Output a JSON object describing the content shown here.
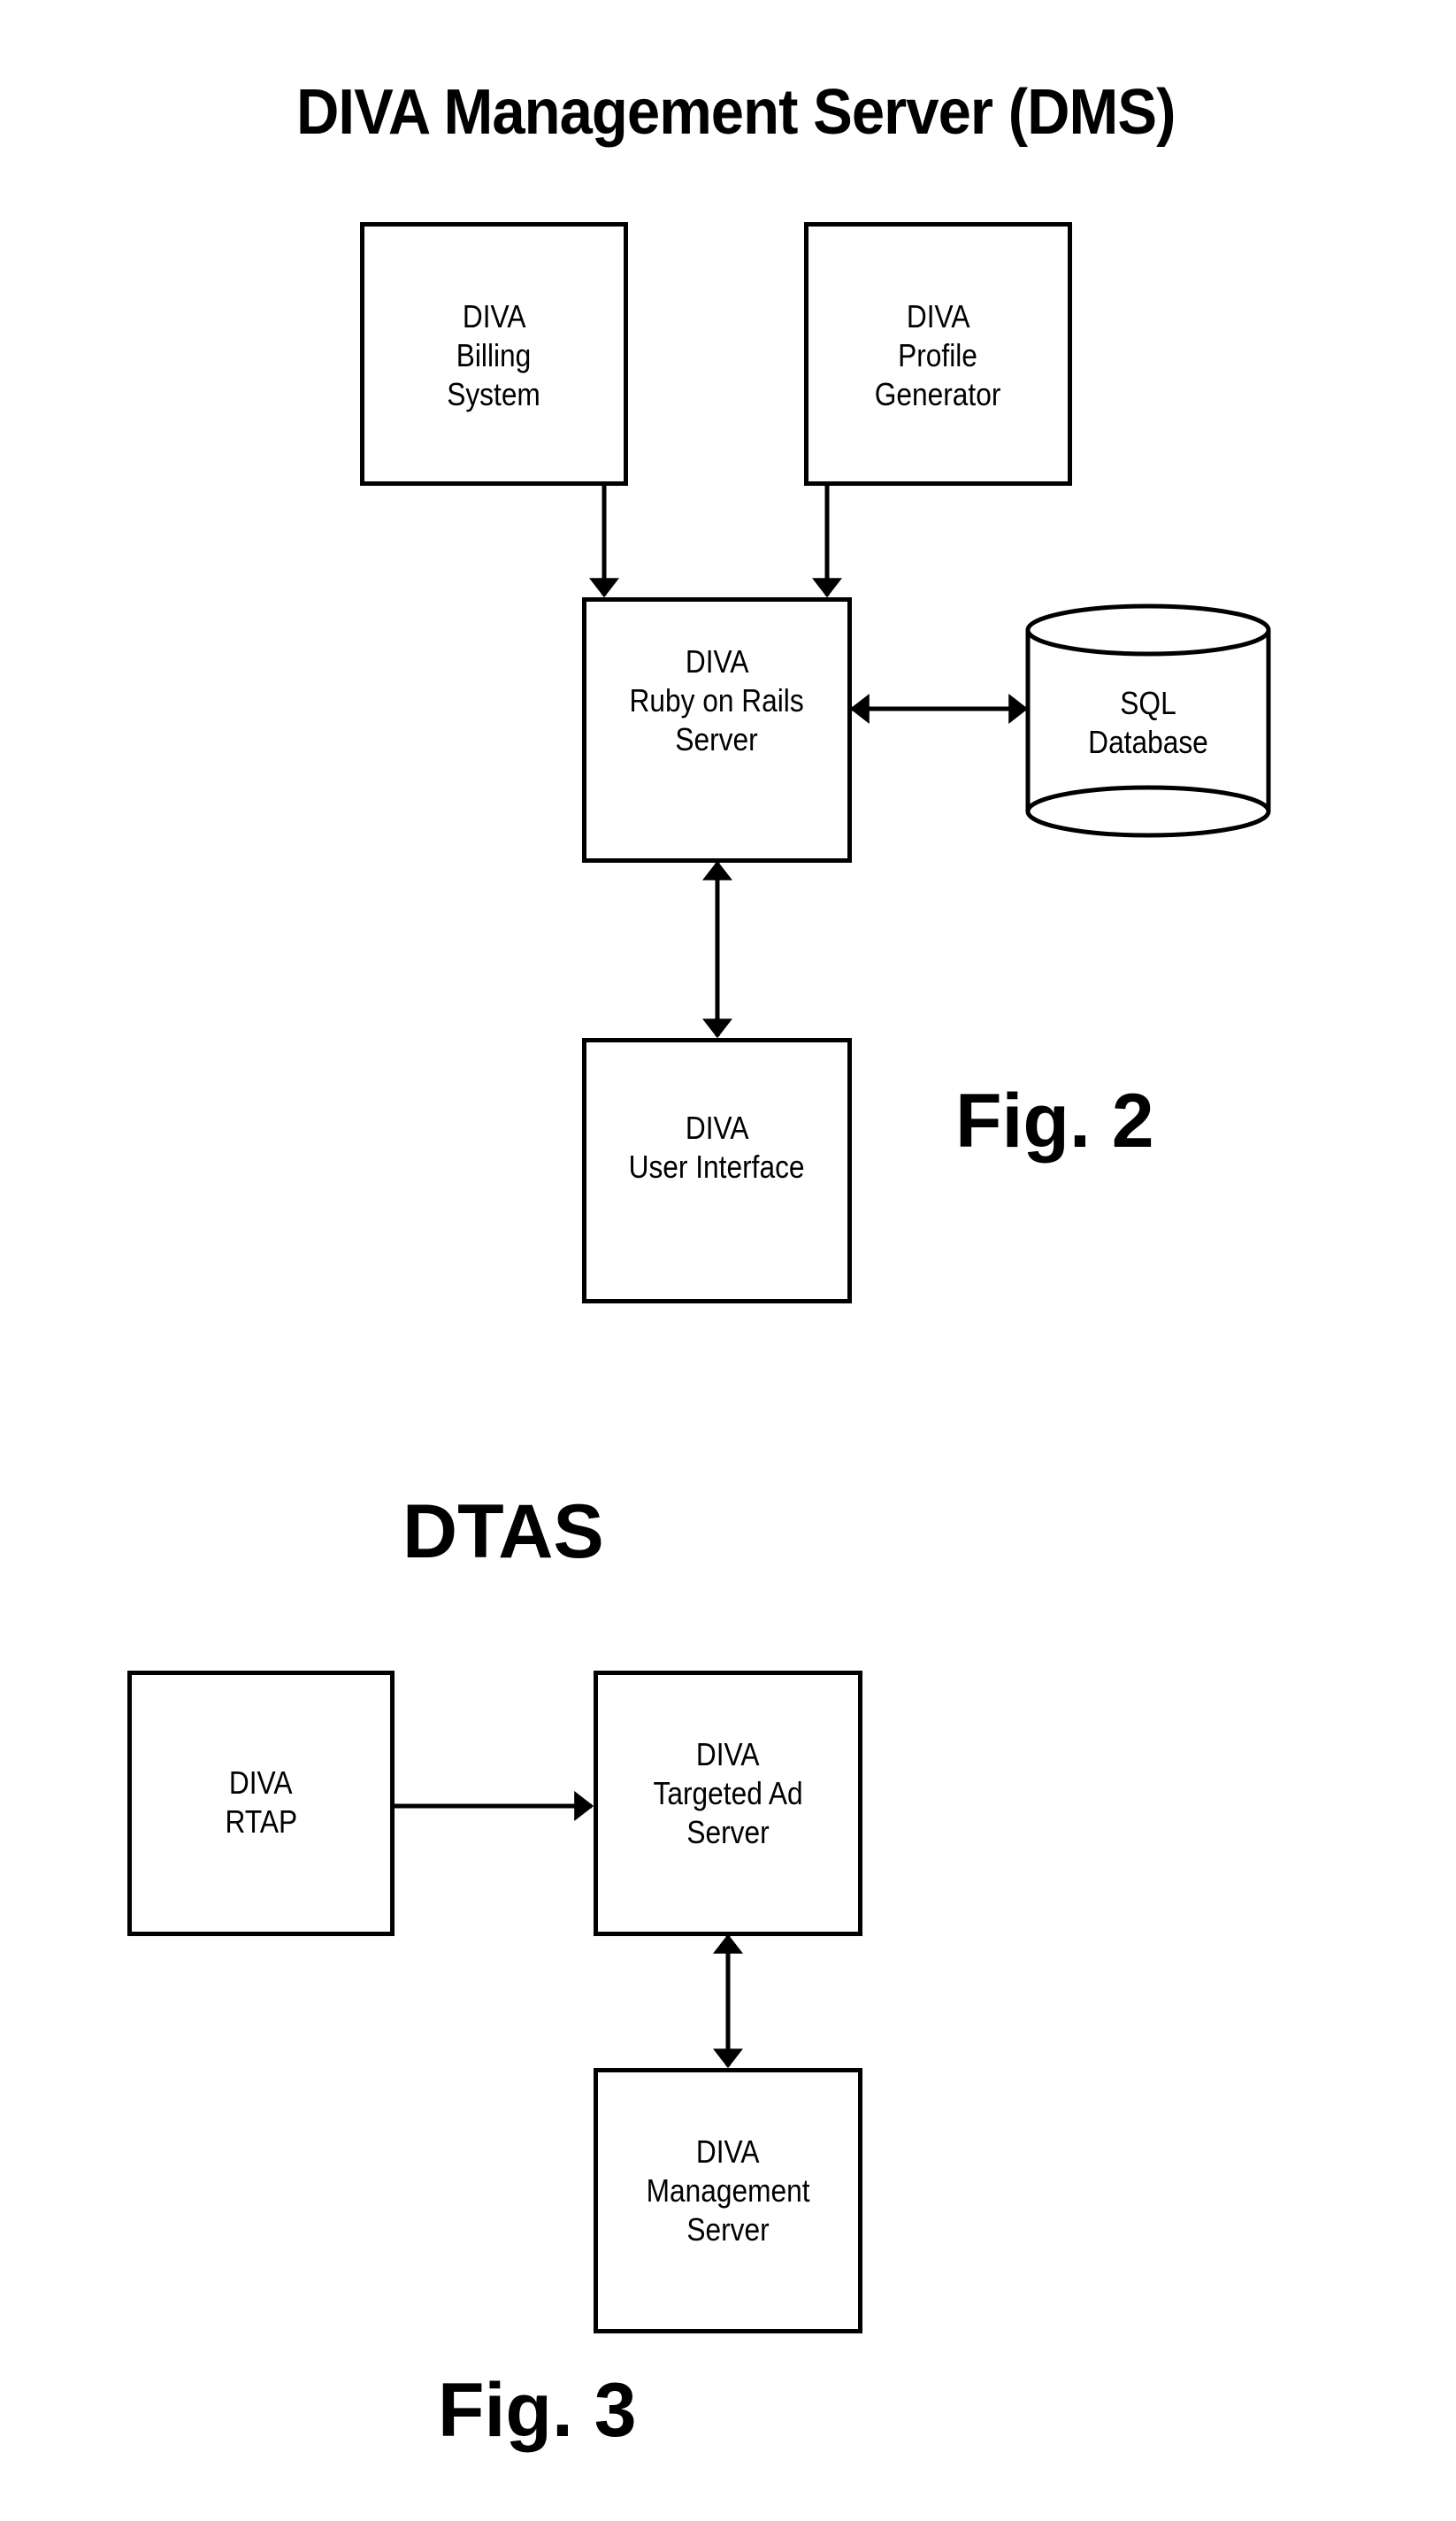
{
  "fig2": {
    "title": "DIVA Management Server (DMS)",
    "caption": "Fig.  2",
    "nodes": {
      "billing": {
        "lines": [
          "DIVA",
          "Billing",
          "System"
        ]
      },
      "profile": {
        "lines": [
          "DIVA",
          "Profile",
          "Generator"
        ]
      },
      "rails": {
        "lines": [
          "DIVA",
          "Ruby on Rails",
          "Server"
        ]
      },
      "sql": {
        "lines": [
          "SQL",
          "Database"
        ],
        "shape": "cylinder"
      },
      "ui": {
        "lines": [
          "DIVA",
          "User Interface"
        ]
      }
    },
    "edges": [
      {
        "from": "billing",
        "to": "rails",
        "direction": "one-way"
      },
      {
        "from": "profile",
        "to": "rails",
        "direction": "one-way"
      },
      {
        "from": "rails",
        "to": "sql",
        "direction": "bidirectional"
      },
      {
        "from": "rails",
        "to": "ui",
        "direction": "bidirectional"
      }
    ]
  },
  "fig3": {
    "title": "DTAS",
    "caption": "Fig. 3",
    "nodes": {
      "rtap": {
        "lines": [
          "DIVA",
          "RTAP"
        ]
      },
      "targeted": {
        "lines": [
          "DIVA",
          "Targeted Ad",
          "Server"
        ]
      },
      "mgmt": {
        "lines": [
          "DIVA",
          "Management",
          "Server"
        ]
      }
    },
    "edges": [
      {
        "from": "rtap",
        "to": "targeted",
        "direction": "one-way"
      },
      {
        "from": "targeted",
        "to": "mgmt",
        "direction": "bidirectional"
      }
    ]
  },
  "colors": {
    "stroke": "#000000",
    "background": "#ffffff"
  }
}
